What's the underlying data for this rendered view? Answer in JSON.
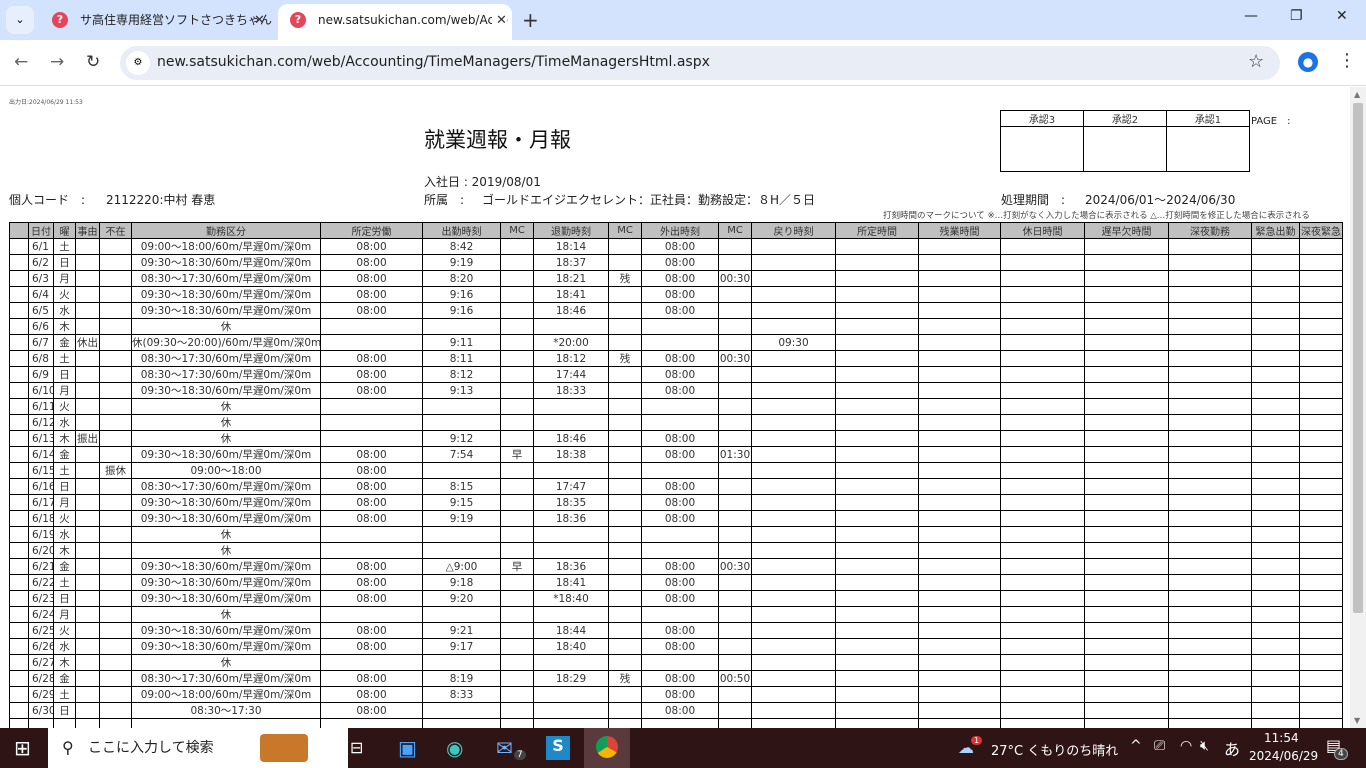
{
  "browser": {
    "tabs": [
      {
        "title": "サ高住専用経営ソフトさつきちゃん",
        "active": false
      },
      {
        "title": "new.satsukichan.com/web/Acco",
        "active": true
      }
    ],
    "url": "new.satsukichan.com/web/Accounting/TimeManagers/TimeManagersHtml.aspx"
  },
  "report": {
    "output_date": "出力日:2024/06/29 11:53",
    "title": "就業週報・月報",
    "approvals": [
      "承認3",
      "承認2",
      "承認1"
    ],
    "page_label": "PAGE　:",
    "hire_date": "入社日 : 2019/08/01",
    "personal_code_label": "個人コード　:",
    "personal_code": "2112220:中村 春恵",
    "affiliation_label": "所属　:",
    "affiliation": "ゴールドエイジエクセレント：正社員：勤務設定：８H／５日",
    "period_label": "処理期間　:",
    "period": "2024/06/01～2024/06/30",
    "mark_note": "打刻時間のマークについて ※…打刻がなく入力した場合に表示される △…打刻時間を修正した場合に表示される"
  },
  "table": {
    "headers": [
      "",
      "日付",
      "曜",
      "事由",
      "不在",
      "勤務区分",
      "所定労働",
      "出勤時刻",
      "MC",
      "退勤時刻",
      "MC",
      "外出時刻",
      "MC",
      "戻り時刻",
      "所定時間",
      "残業時間",
      "休日時間",
      "遅早欠時間",
      "深夜勤務",
      "緊急出勤",
      "深夜緊急"
    ],
    "rows": [
      [
        "6/1",
        "土",
        "",
        "",
        "09:00～18:00/60m/早遅0m/深0m",
        "08:00",
        "8:42",
        "",
        "18:14",
        "",
        "08:00",
        "",
        ""
      ],
      [
        "6/2",
        "日",
        "",
        "",
        "09:30～18:30/60m/早遅0m/深0m",
        "08:00",
        "9:19",
        "",
        "18:37",
        "",
        "08:00",
        "",
        ""
      ],
      [
        "6/3",
        "月",
        "",
        "",
        "08:30～17:30/60m/早遅0m/深0m",
        "08:00",
        "8:20",
        "",
        "18:21",
        "残",
        "08:00",
        "00:30",
        ""
      ],
      [
        "6/4",
        "火",
        "",
        "",
        "09:30～18:30/60m/早遅0m/深0m",
        "08:00",
        "9:16",
        "",
        "18:41",
        "",
        "08:00",
        "",
        ""
      ],
      [
        "6/5",
        "水",
        "",
        "",
        "09:30～18:30/60m/早遅0m/深0m",
        "08:00",
        "9:16",
        "",
        "18:46",
        "",
        "08:00",
        "",
        ""
      ],
      [
        "6/6",
        "木",
        "",
        "",
        "休",
        "",
        "",
        "",
        "",
        "",
        "",
        "",
        ""
      ],
      [
        "6/7",
        "金",
        "休出",
        "",
        "休(09:30～20:00)/60m/早遅0m/深0m",
        "",
        "9:11",
        "",
        "*20:00",
        "",
        "",
        "",
        "09:30"
      ],
      [
        "6/8",
        "土",
        "",
        "",
        "08:30～17:30/60m/早遅0m/深0m",
        "08:00",
        "8:11",
        "",
        "18:12",
        "残",
        "08:00",
        "00:30",
        ""
      ],
      [
        "6/9",
        "日",
        "",
        "",
        "08:30～17:30/60m/早遅0m/深0m",
        "08:00",
        "8:12",
        "",
        "17:44",
        "",
        "08:00",
        "",
        ""
      ],
      [
        "6/10",
        "月",
        "",
        "",
        "09:30～18:30/60m/早遅0m/深0m",
        "08:00",
        "9:13",
        "",
        "18:33",
        "",
        "08:00",
        "",
        ""
      ],
      [
        "6/11",
        "火",
        "",
        "",
        "休",
        "",
        "",
        "",
        "",
        "",
        "",
        "",
        ""
      ],
      [
        "6/12",
        "水",
        "",
        "",
        "休",
        "",
        "",
        "",
        "",
        "",
        "",
        "",
        ""
      ],
      [
        "6/13",
        "木",
        "振出",
        "",
        "休",
        "",
        "9:12",
        "",
        "18:46",
        "",
        "08:00",
        "",
        ""
      ],
      [
        "6/14",
        "金",
        "",
        "",
        "09:30～18:30/60m/早遅0m/深0m",
        "08:00",
        "7:54",
        "早",
        "18:38",
        "",
        "08:00",
        "01:30",
        ""
      ],
      [
        "6/15",
        "土",
        "",
        "振休",
        "09:00～18:00",
        "08:00",
        "",
        "",
        "",
        "",
        "",
        "",
        ""
      ],
      [
        "6/16",
        "日",
        "",
        "",
        "08:30～17:30/60m/早遅0m/深0m",
        "08:00",
        "8:15",
        "",
        "17:47",
        "",
        "08:00",
        "",
        ""
      ],
      [
        "6/17",
        "月",
        "",
        "",
        "09:30～18:30/60m/早遅0m/深0m",
        "08:00",
        "9:15",
        "",
        "18:35",
        "",
        "08:00",
        "",
        ""
      ],
      [
        "6/18",
        "火",
        "",
        "",
        "09:30～18:30/60m/早遅0m/深0m",
        "08:00",
        "9:19",
        "",
        "18:36",
        "",
        "08:00",
        "",
        ""
      ],
      [
        "6/19",
        "水",
        "",
        "",
        "休",
        "",
        "",
        "",
        "",
        "",
        "",
        "",
        ""
      ],
      [
        "6/20",
        "木",
        "",
        "",
        "休",
        "",
        "",
        "",
        "",
        "",
        "",
        "",
        ""
      ],
      [
        "6/21",
        "金",
        "",
        "",
        "09:30～18:30/60m/早遅0m/深0m",
        "08:00",
        "△9:00",
        "早",
        "18:36",
        "",
        "08:00",
        "00:30",
        ""
      ],
      [
        "6/22",
        "土",
        "",
        "",
        "09:30～18:30/60m/早遅0m/深0m",
        "08:00",
        "9:18",
        "",
        "18:41",
        "",
        "08:00",
        "",
        ""
      ],
      [
        "6/23",
        "日",
        "",
        "",
        "09:30～18:30/60m/早遅0m/深0m",
        "08:00",
        "9:20",
        "",
        "*18:40",
        "",
        "08:00",
        "",
        ""
      ],
      [
        "6/24",
        "月",
        "",
        "",
        "休",
        "",
        "",
        "",
        "",
        "",
        "",
        "",
        ""
      ],
      [
        "6/25",
        "火",
        "",
        "",
        "09:30～18:30/60m/早遅0m/深0m",
        "08:00",
        "9:21",
        "",
        "18:44",
        "",
        "08:00",
        "",
        ""
      ],
      [
        "6/26",
        "水",
        "",
        "",
        "09:30～18:30/60m/早遅0m/深0m",
        "08:00",
        "9:17",
        "",
        "18:40",
        "",
        "08:00",
        "",
        ""
      ],
      [
        "6/27",
        "木",
        "",
        "",
        "休",
        "",
        "",
        "",
        "",
        "",
        "",
        "",
        ""
      ],
      [
        "6/28",
        "金",
        "",
        "",
        "08:30～17:30/60m/早遅0m/深0m",
        "08:00",
        "8:19",
        "",
        "18:29",
        "残",
        "08:00",
        "00:50",
        ""
      ],
      [
        "6/29",
        "土",
        "",
        "",
        "09:00～18:00/60m/早遅0m/深0m",
        "08:00",
        "8:33",
        "",
        "",
        "",
        "08:00",
        "",
        ""
      ],
      [
        "6/30",
        "日",
        "",
        "",
        "08:30～17:30",
        "08:00",
        "",
        "",
        "",
        "",
        "08:00",
        "",
        ""
      ]
    ]
  },
  "taskbar": {
    "search_placeholder": "ここに入力して検索",
    "weather": "27°C くもりのち晴れ",
    "weather_badge": "1",
    "ime": "あ",
    "time": "11:54",
    "date": "2024/06/29",
    "mail_badge": "7",
    "notification_count": "4"
  }
}
